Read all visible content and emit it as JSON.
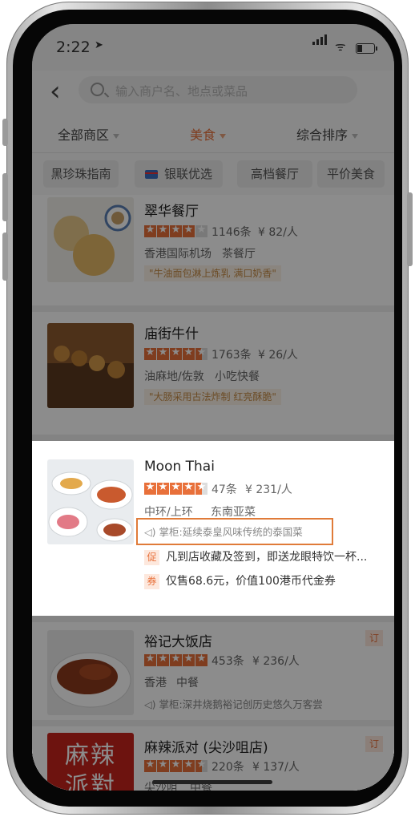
{
  "status_bar": {
    "time": "2:22",
    "location_arrow": "➤",
    "wifi_glyph": "ᯤ"
  },
  "header": {
    "back_glyph": "‹",
    "search_placeholder": "输入商户名、地点或菜品"
  },
  "filters": [
    {
      "label": "全部商区",
      "active": false
    },
    {
      "label": "美食",
      "active": true
    },
    {
      "label": "综合排序",
      "active": false
    }
  ],
  "chips": [
    "黑珍珠指南",
    "银联优选",
    "高档餐厅",
    "平价美食"
  ],
  "restaurants": [
    {
      "name": "翠华餐厅",
      "rating": 4,
      "reviews": "1146条",
      "price": "¥ 82/人",
      "location": "香港国际机场",
      "category": "茶餐厅",
      "quote": "\"牛油面包淋上炼乳 满口奶香\""
    },
    {
      "name": "庙街牛什",
      "rating": 4.5,
      "reviews": "1763条",
      "price": "¥ 26/人",
      "location": "油麻地/佐敦",
      "category": "小吃快餐",
      "quote": "\"大肠采用古法炸制 红亮酥脆\""
    },
    {
      "name": "Moon Thai",
      "rating": 4.5,
      "reviews": "47条",
      "price": "¥ 231/人",
      "location": "中环/上环",
      "category": "东南亚菜",
      "message": "掌柜:延续泰皇风味传统的泰国菜",
      "promo_tag": "促",
      "promo": "凡到店收藏及签到，即送龙眼特饮一杯...",
      "coupon_tag": "券",
      "coupon": "仅售68.6元，价值100港币代金券"
    },
    {
      "name": "裕记大饭店",
      "rating": 5,
      "reviews": "453条",
      "price": "¥ 236/人",
      "location": "香港",
      "category": "中餐",
      "message": "掌柜:深井烧鹅裕记创历史悠久万客尝",
      "order_tag": "订"
    },
    {
      "name": "麻辣派对 (尖沙咀店)",
      "rating": 4.5,
      "reviews": "220条",
      "price": "¥ 137/人",
      "location": "尖沙咀",
      "category": "中餐",
      "order_tag": "订",
      "logo_text": "麻辣派對"
    }
  ],
  "colors": {
    "accent": "#e8703a",
    "highlight_box": "#e07b39",
    "quote_text": "#c58b45"
  }
}
